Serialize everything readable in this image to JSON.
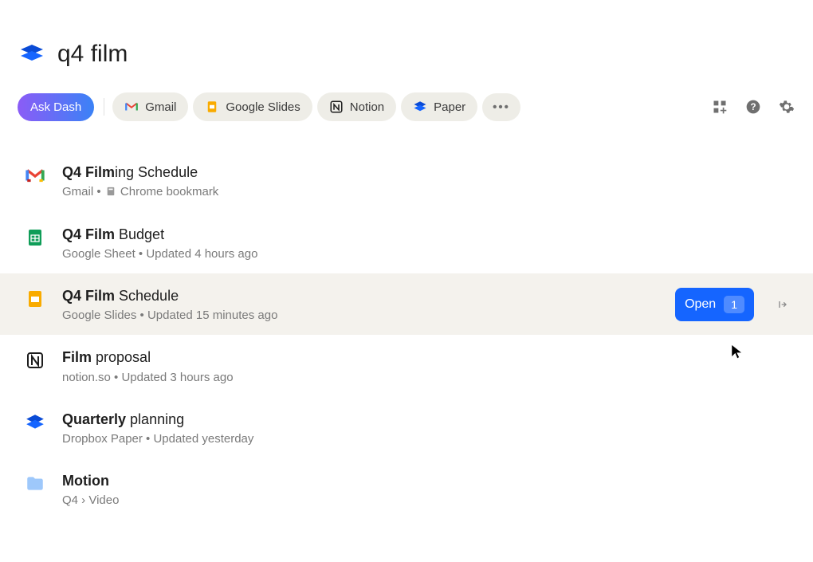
{
  "search_query": "q4 film",
  "ask_dash_label": "Ask Dash",
  "filters": {
    "gmail": "Gmail",
    "google_slides": "Google Slides",
    "notion": "Notion",
    "paper": "Paper"
  },
  "results": [
    {
      "title_bold": "Q4 Film",
      "title_rest": "ing Schedule",
      "meta_prefix": "Gmail • ",
      "meta_suffix": " Chrome bookmark"
    },
    {
      "title_bold": "Q4 Film",
      "title_rest": " Budget",
      "meta": "Google Sheet • Updated 4 hours ago"
    },
    {
      "title_bold": "Q4 Film",
      "title_rest": " Schedule",
      "meta": "Google Slides • Updated 15 minutes ago"
    },
    {
      "title_bold": "Film",
      "title_rest": " proposal",
      "meta": "notion.so • Updated 3 hours ago"
    },
    {
      "title_bold": "Quarterly",
      "title_rest": " planning",
      "meta": "Dropbox Paper • Updated yesterday"
    },
    {
      "title_bold": "Motion",
      "title_rest": "",
      "meta": "Q4  ›  Video"
    }
  ],
  "open_button": {
    "label": "Open",
    "badge": "1"
  }
}
